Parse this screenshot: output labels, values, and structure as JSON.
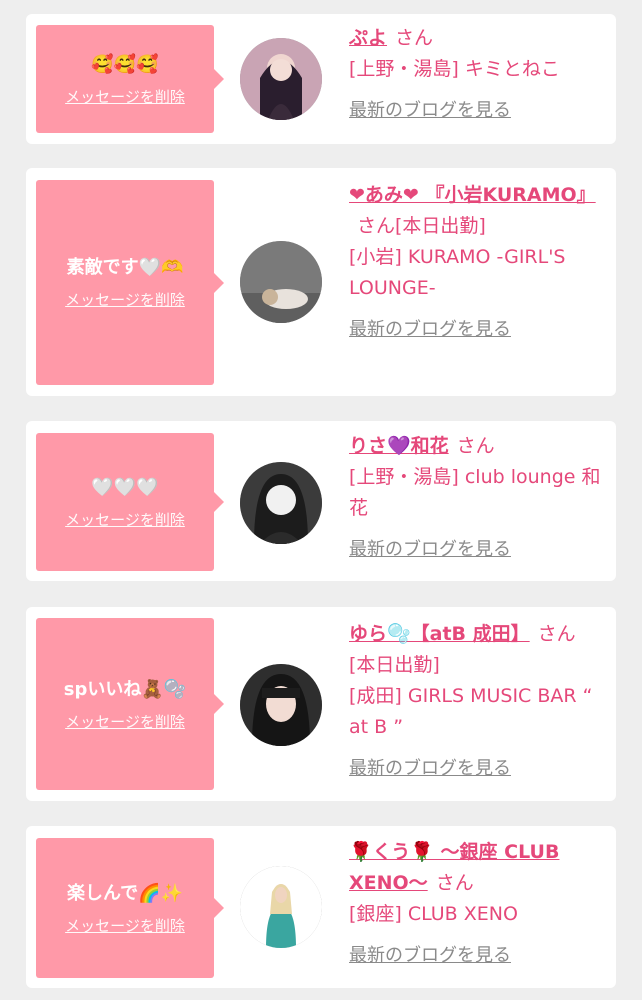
{
  "entries": [
    {
      "message": "🥰🥰🥰",
      "delete_label": "メッセージを削除",
      "name": "ぷよ",
      "suffix": "さん",
      "shop": "[上野・湯島] キミとねこ",
      "blog_label": "最新のブログを見る"
    },
    {
      "message": "素敵です🤍🫶",
      "delete_label": "メッセージを削除",
      "name": "❤あみ❤ 『小岩KURAMO』",
      "suffix": "さん[本日出勤]",
      "shop": "[小岩] KURAMO -GIRL'S LOUNGE-",
      "blog_label": "最新のブログを見る"
    },
    {
      "message": "🤍🤍🤍",
      "delete_label": "メッセージを削除",
      "name": "りさ💜和花",
      "suffix": "さん",
      "shop": "[上野・湯島] club lounge 和花",
      "blog_label": "最新のブログを見る"
    },
    {
      "message": "spいいね🧸🫧",
      "delete_label": "メッセージを削除",
      "name": "ゆら🫧【atB 成田】",
      "suffix": "さん",
      "status": "[本日出勤]",
      "shop": "[成田] GIRLS MUSIC BAR “ at B ”",
      "blog_label": "最新のブログを見る"
    },
    {
      "message": "楽しんで🌈✨",
      "delete_label": "メッセージを削除",
      "name": "🌹くう🌹 〜銀座 CLUB XENO〜",
      "suffix": "さん",
      "shop": "[銀座] CLUB XENO",
      "blog_label": "最新のブログを見る"
    }
  ],
  "colors": {
    "bubble": "#ff99a8",
    "accent": "#e5487a",
    "muted": "#8a8a8a",
    "background": "#eeeeee"
  }
}
